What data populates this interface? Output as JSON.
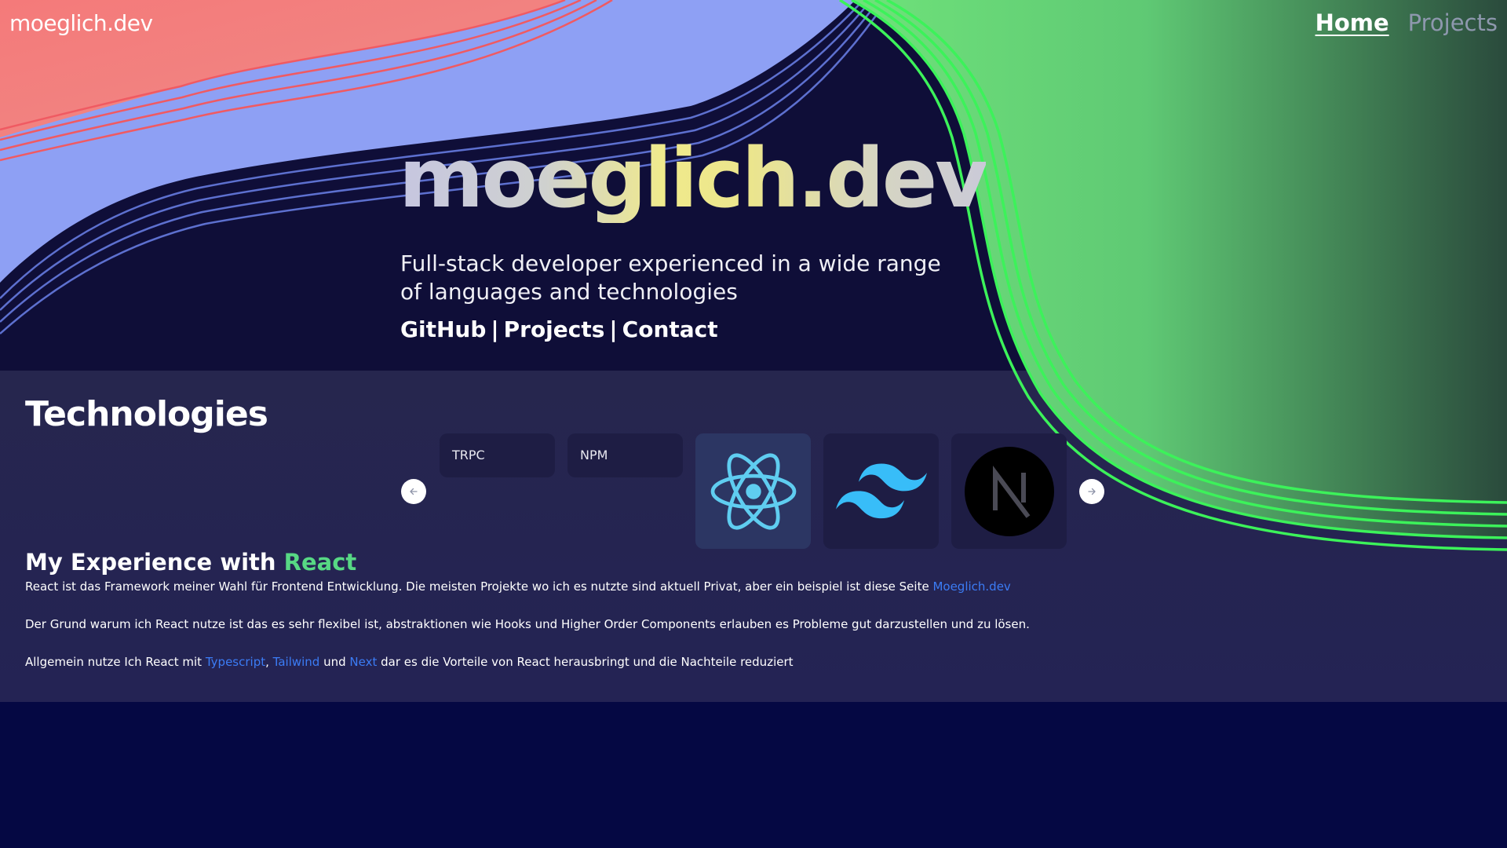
{
  "nav": {
    "logo": "moeglich.dev",
    "links": [
      {
        "label": "Home",
        "active": true
      },
      {
        "label": "Projects",
        "active": false
      }
    ]
  },
  "hero": {
    "title": "moeglich.dev",
    "subtitle": "Full-stack developer experienced in a wide range of languages and technologies",
    "links": [
      "GitHub",
      "Projects",
      "Contact"
    ],
    "separator": "|"
  },
  "technologies": {
    "heading": "Technologies",
    "cards": [
      {
        "label": "TRPC",
        "kind": "text"
      },
      {
        "label": "NPM",
        "kind": "text"
      },
      {
        "label": "React",
        "kind": "icon",
        "icon": "react-icon",
        "active": true
      },
      {
        "label": "Tailwind",
        "kind": "icon",
        "icon": "tailwind-icon"
      },
      {
        "label": "Next",
        "kind": "icon",
        "icon": "nextjs-icon"
      }
    ],
    "prev_icon": "arrow-left-icon",
    "next_icon": "arrow-right-icon"
  },
  "experience": {
    "heading_prefix": "My Experience with ",
    "heading_accent": "React",
    "p1_text": "React ist das Framework meiner Wahl für Frontend Entwicklung. Die meisten Projekte wo ich es nutzte sind aktuell Privat, aber ein beispiel ist diese Seite ",
    "p1_link": "Moeglich.dev",
    "p2_text": "Der Grund warum ich React nutze ist das es sehr flexibel ist, abstraktionen wie Hooks und Higher Order Components erlauben es Probleme gut darzustellen und zu lösen.",
    "p3_text_a": "Allgemein nutze Ich React mit ",
    "p3_link_1": "Typescript",
    "p3_sep_1": ", ",
    "p3_link_2": "Tailwind",
    "p3_sep_2": " und ",
    "p3_link_3": "Next",
    "p3_text_b": " dar es die Vorteile von React herausbringt und die Nachteile reduziert"
  },
  "colors": {
    "page_bg": "#050843",
    "hero_bg": "#0f0e38",
    "section_bg": "#26264e",
    "accent_green": "#57d884",
    "link_blue": "#3b7cf5",
    "wave_salmon": "#f47a7a",
    "wave_periwinkle": "#8ea0f4",
    "blob_green": "#6fe27a"
  }
}
